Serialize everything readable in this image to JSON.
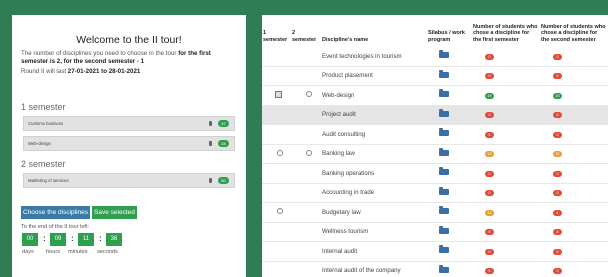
{
  "left": {
    "welcome": "Welcome to the II tour!",
    "intro_prefix": "The number of disciplines you need to choose in the tour ",
    "intro_bold": "for the first semester is 2, for the second semester - 1",
    "round_prefix": "Round II will last ",
    "round_dates": "27-01-2021 to 28-01-2021",
    "semester1_title": "1 semester",
    "semester1_items": [
      {
        "name": "Customs business",
        "count": "37",
        "icon": "trash-icon"
      },
      {
        "name": "Web-design",
        "count": "28",
        "icon": "trash-icon"
      }
    ],
    "semester2_title": "2 semester",
    "semester2_items": [
      {
        "name": "Marketing of services",
        "count": "50",
        "icon": "trash-icon"
      }
    ],
    "choose_button": "Choose the disciplines",
    "save_button": "Save selected",
    "timer_label": "To the end of the II tour left:",
    "timer": {
      "days": "00",
      "hours": "09",
      "minutes": "11",
      "seconds": "36"
    },
    "timer_units": {
      "days": "days",
      "hours": "hours",
      "minutes": "minutes",
      "seconds": "seconds"
    }
  },
  "table": {
    "headers": {
      "sem1_num": "1",
      "sem1_label": "semester",
      "sem2_num": "2",
      "sem2_label": "semester",
      "discipline": "Discipline's name",
      "syllabus": "Silabus / work program",
      "first": "Number of students who chose a discipline for the first semester",
      "second": "Number of students who chose a discipline for the second semester"
    },
    "rows": [
      {
        "name": "Event technologies in tourism",
        "sem1": "",
        "sem2": "",
        "first": "0",
        "first_color": "red",
        "second": "0",
        "second_color": "red",
        "highlight": false
      },
      {
        "name": "Product plasement",
        "sem1": "",
        "sem2": "",
        "first": "0",
        "first_color": "red",
        "second": "0",
        "second_color": "red",
        "highlight": false
      },
      {
        "name": "Web-design",
        "sem1": "checked",
        "sem2": "radio",
        "first": "19",
        "first_color": "green",
        "second": "23",
        "second_color": "green",
        "highlight": false
      },
      {
        "name": "Project audit",
        "sem1": "",
        "sem2": "",
        "first": "0",
        "first_color": "red",
        "second": "0",
        "second_color": "red",
        "highlight": true
      },
      {
        "name": "Audit consulting",
        "sem1": "",
        "sem2": "",
        "first": "0",
        "first_color": "red",
        "second": "0",
        "second_color": "red",
        "highlight": false
      },
      {
        "name": "Banking law",
        "sem1": "radio",
        "sem2": "radio",
        "first": "12",
        "first_color": "orange",
        "second": "12",
        "second_color": "orange",
        "highlight": false
      },
      {
        "name": "Banking operations",
        "sem1": "",
        "sem2": "",
        "first": "0",
        "first_color": "red",
        "second": "0",
        "second_color": "red",
        "highlight": false
      },
      {
        "name": "Accounting in trade",
        "sem1": "",
        "sem2": "",
        "first": "0",
        "first_color": "red",
        "second": "0",
        "second_color": "red",
        "highlight": false
      },
      {
        "name": "Budgetary law",
        "sem1": "radio",
        "sem2": "",
        "first": "11",
        "first_color": "orange",
        "second": "4",
        "second_color": "red",
        "highlight": false
      },
      {
        "name": "Wellness tourism",
        "sem1": "",
        "sem2": "",
        "first": "0",
        "first_color": "red",
        "second": "4",
        "second_color": "red",
        "highlight": false
      },
      {
        "name": "Internal audit",
        "sem1": "",
        "sem2": "",
        "first": "0",
        "first_color": "red",
        "second": "0",
        "second_color": "red",
        "highlight": false
      },
      {
        "name": "Internal audit of the company",
        "sem1": "",
        "sem2": "",
        "first": "0",
        "first_color": "red",
        "second": "0",
        "second_color": "red",
        "highlight": false
      }
    ]
  },
  "colors": {
    "background": "#2f7d55",
    "green": "#2e9e4f",
    "red": "#e04b3a",
    "orange": "#e8a030",
    "blue_button": "#3a7aa7",
    "folder": "#3a6ea5"
  }
}
